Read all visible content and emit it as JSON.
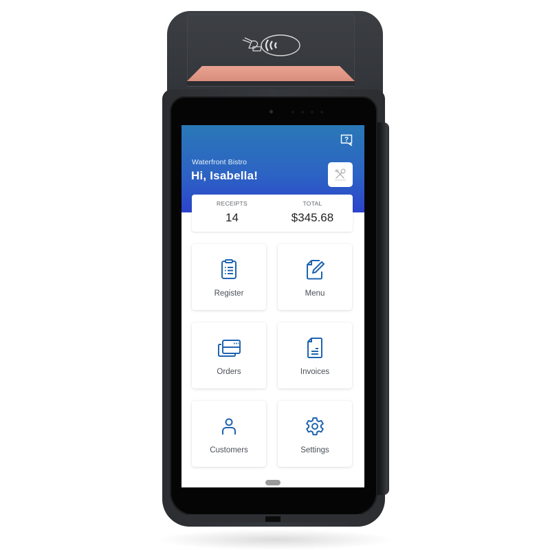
{
  "device": {
    "nfc_logo": "contactless-payment-icon"
  },
  "header": {
    "help_icon": "help-chat-icon",
    "venue_name": "Waterfront Bistro",
    "greeting": "Hi, Isabella!",
    "venue_logo_icon": "fork-spoon-icon"
  },
  "stats": [
    {
      "label": "RECEIPTS",
      "value": "14"
    },
    {
      "label": "TOTAL",
      "value": "$345.68"
    }
  ],
  "tiles": [
    {
      "label": "Register",
      "icon": "clipboard-list-icon"
    },
    {
      "label": "Menu",
      "icon": "edit-document-icon"
    },
    {
      "label": "Orders",
      "icon": "cards-icon"
    },
    {
      "label": "Invoices",
      "icon": "invoice-icon"
    },
    {
      "label": "Customers",
      "icon": "person-icon"
    },
    {
      "label": "Settings",
      "icon": "gear-icon"
    }
  ],
  "colors": {
    "accent": "#1e63b0",
    "header_top": "#2a78b7",
    "header_bottom": "#2c44cc",
    "paper": "#e39a88"
  }
}
